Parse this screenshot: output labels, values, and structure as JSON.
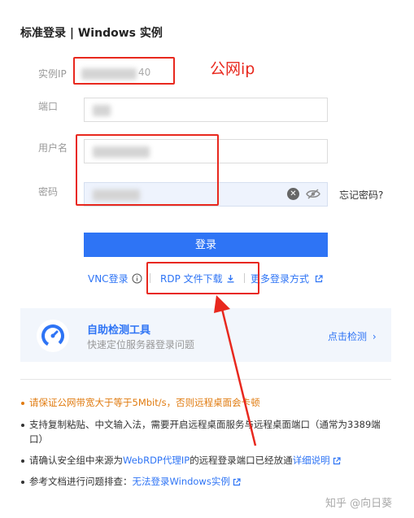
{
  "header": {
    "title": "标准登录 | Windows 实例"
  },
  "form": {
    "ip_label": "实例IP",
    "ip_value_suffix": "40",
    "port_label": "端口",
    "username_label": "用户名",
    "password_label": "密码",
    "forgot_label": "忘记密码?",
    "login_label": "登录"
  },
  "annotation": {
    "text": "公网ip"
  },
  "alt_login": {
    "vnc_label": "VNC登录",
    "rdp_label": "RDP 文件下载",
    "more_label": "更多登录方式"
  },
  "tool": {
    "title": "自助检测工具",
    "subtitle": "快速定位服务器登录问题",
    "link": "点击检测"
  },
  "tips": {
    "t1": "请保证公网带宽大于等于5Mbit/s，否则远程桌面会卡顿",
    "t2": "支持复制粘贴、中文输入法，需要开启远程桌面服务与远程桌面端口（通常为3389端口）",
    "t3_a": "请确认安全组中来源为",
    "t3_b": "WebRDP代理IP",
    "t3_c": "的远程登录端口已经放通",
    "t3_d": "详细说明",
    "t4_a": "参考文档进行问题排查：",
    "t4_b": "无法登录Windows实例"
  },
  "watermark": {
    "text": "知乎 @向日葵"
  },
  "colors": {
    "accent": "#2e74f5",
    "warning": "#e07b10",
    "annotation_red": "#e8281e"
  }
}
